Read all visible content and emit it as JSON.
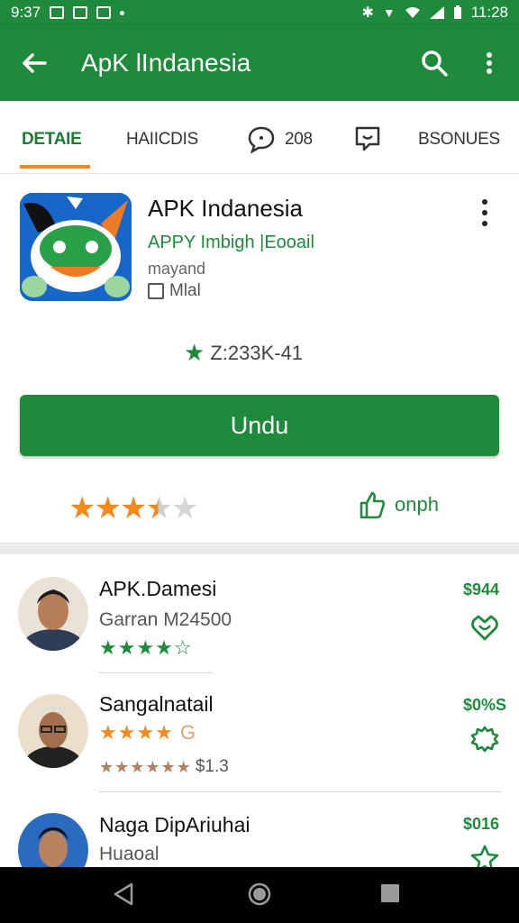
{
  "status_bar": {
    "time_left": "9:37",
    "time_right": "11:28"
  },
  "app_bar": {
    "title": "ApK lIndanesia"
  },
  "tabs": [
    {
      "label": "DETAIE",
      "active": true
    },
    {
      "label": "HAIICDIS",
      "active": false
    },
    {
      "label": "208",
      "active": false
    },
    {
      "label": "BSONUES",
      "active": false
    }
  ],
  "app": {
    "name": "APK Indanesia",
    "developer": "APPY Imbigh |Eooail",
    "category": "mayand",
    "badge": "Mlal",
    "rating_text": "Z:233K-41",
    "install_label": "Undu",
    "share_label": "onph",
    "star_rating": 3.5
  },
  "reviews": [
    {
      "name": "APK.Damesi",
      "sub": "Garran M24500",
      "stars": "★★★★☆",
      "price": "$944"
    },
    {
      "name": "Sangalnatail",
      "sub_stars": "★★★★",
      "sub_extra": "G",
      "stars_small": "★★★★★★",
      "stars_count": "$1.3",
      "price": "$0%S"
    },
    {
      "name": "Naga DipAriuhai",
      "sub": "Huaoal",
      "price": "$016"
    }
  ],
  "colors": {
    "brand": "#1f8a3b",
    "accent": "#ee8a1f",
    "star_orange": "#f08a1d"
  }
}
